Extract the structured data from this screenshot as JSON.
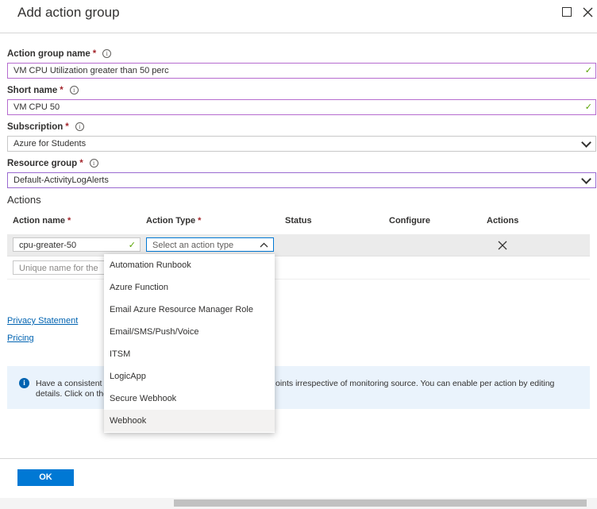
{
  "header": {
    "title": "Add action group"
  },
  "form": {
    "action_group_name": {
      "label": "Action group name",
      "value": "VM CPU Utilization greater than 50 perc"
    },
    "short_name": {
      "label": "Short name",
      "value": "VM CPU 50"
    },
    "subscription": {
      "label": "Subscription",
      "value": "Azure for Students"
    },
    "resource_group": {
      "label": "Resource group",
      "value": "Default-ActivityLogAlerts"
    },
    "required_mark": "*"
  },
  "actions": {
    "section_title": "Actions",
    "columns": [
      "Action name",
      "Action Type",
      "Status",
      "Configure",
      "Actions"
    ],
    "row": {
      "name_value": "cpu-greater-50",
      "type_placeholder": "Select an action type"
    },
    "new_name_placeholder": "Unique name for the",
    "dropdown_options": [
      "Automation Runbook",
      "Azure Function",
      "Email Azure Resource Manager Role",
      "Email/SMS/Push/Voice",
      "ITSM",
      "LogicApp",
      "Secure Webhook",
      "Webhook"
    ],
    "highlighted_option": "Webhook"
  },
  "links": {
    "privacy": "Privacy Statement",
    "pricing": "Pricing"
  },
  "banner": {
    "line1_left": "Have a consistent t",
    "line1_right": "oints irrespective of monitoring source. You can enable per action by editing",
    "line2": "details. Click on the"
  },
  "footer": {
    "ok_label": "OK"
  },
  "colors": {
    "accent": "#0078d4",
    "valid": "#57a300",
    "required": "#a4262c",
    "link": "#0063b1"
  }
}
